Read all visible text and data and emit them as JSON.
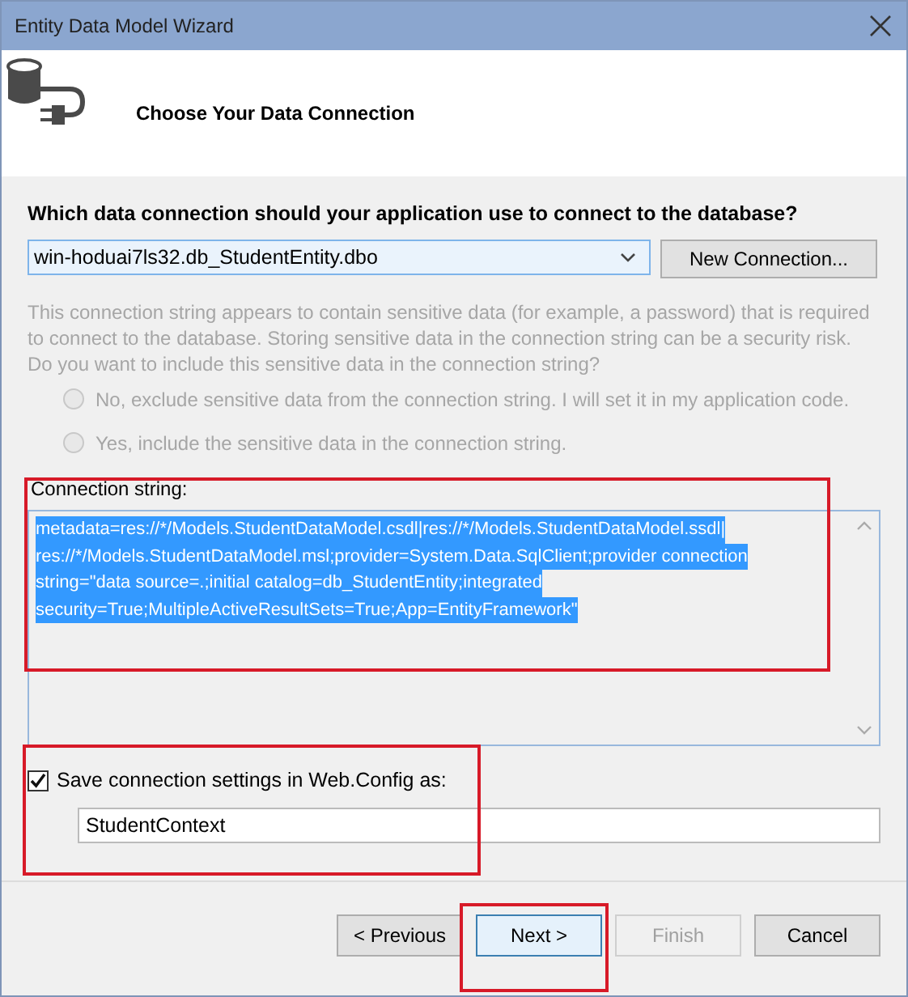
{
  "window": {
    "title": "Entity Data Model Wizard"
  },
  "header": {
    "title": "Choose Your Data Connection"
  },
  "question": "Which data connection should your application use to connect to the database?",
  "connection": {
    "value": "win-hoduai7ls32.db_StudentEntity.dbo"
  },
  "new_connection_button": {
    "label": "New Connection..."
  },
  "sensitive_notice": {
    "text": "This connection string appears to contain sensitive data (for example, a password) that is required to connect to the database. Storing sensitive data in the connection string can be a security risk. Do you want to include this sensitive data in the connection string?",
    "disabled": true
  },
  "options": [
    {
      "label": "No, exclude sensitive data from the connection string. I will set it in my application code.",
      "selected": false,
      "disabled": true
    },
    {
      "label": "Yes, include the sensitive data in the connection string.",
      "selected": false,
      "disabled": true
    }
  ],
  "connection_string": {
    "label": "Connection string:",
    "lines": [
      "metadata=res://*/Models.StudentDataModel.csdl|res://*/Models.StudentDataModel.ssdl|",
      "res://*/Models.StudentDataModel.msl;provider=System.Data.SqlClient;provider connection",
      "string=\"data source=.;initial catalog=db_StudentEntity;integrated",
      "security=True;MultipleActiveResultSets=True;App=EntityFramework\""
    ],
    "selected": true
  },
  "save_settings": {
    "label": "Save connection settings in Web.Config as:",
    "checked": true
  },
  "context_name": {
    "value": "StudentContext"
  },
  "buttons": [
    {
      "label": "< Previous",
      "disabled": false,
      "focused": false
    },
    {
      "label": "Next >",
      "disabled": false,
      "focused": true
    },
    {
      "label": "Finish",
      "disabled": true,
      "focused": false
    },
    {
      "label": "Cancel",
      "disabled": false,
      "focused": false
    }
  ]
}
